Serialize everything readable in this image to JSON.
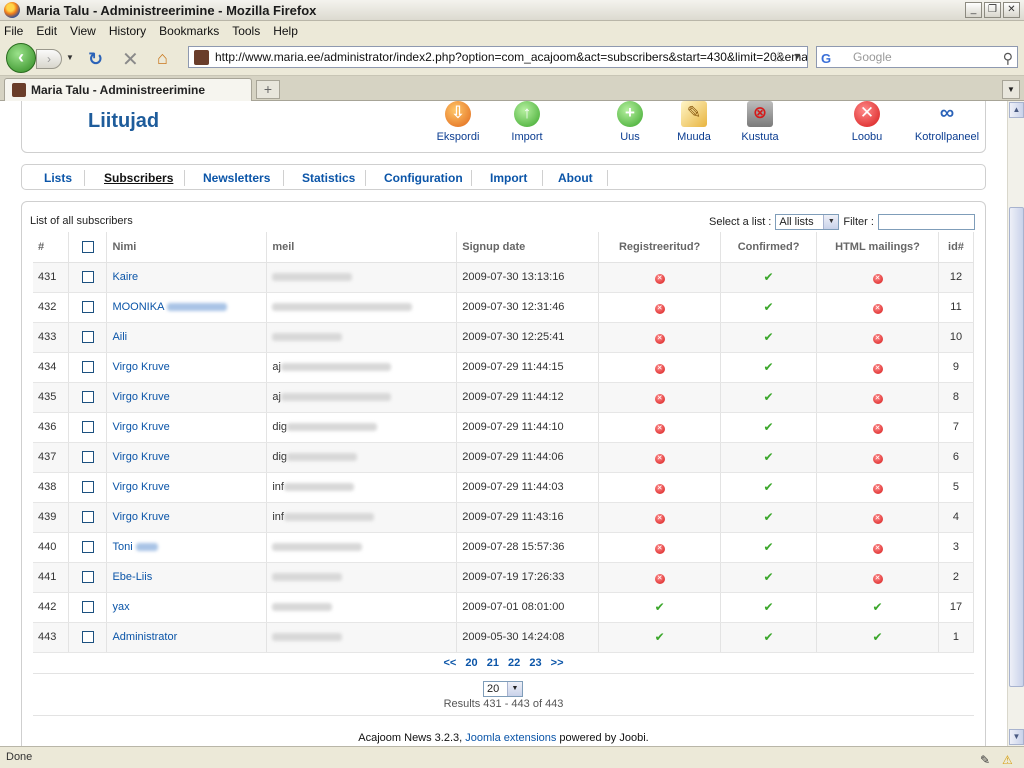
{
  "window": {
    "title": "Maria Talu - Administreerimine - Mozilla Firefox"
  },
  "menu": [
    "File",
    "Edit",
    "View",
    "History",
    "Bookmarks",
    "Tools",
    "Help"
  ],
  "nav": {
    "url": "http://www.maria.ee/administrator/index2.php?option=com_acajoom&act=subscribers&start=430&limit=20&emai",
    "search_placeholder": "Google"
  },
  "tab": {
    "label": "Maria Talu - Administreerimine"
  },
  "page": {
    "title": "Liitujad",
    "tools": [
      "Ekspordi",
      "Import",
      "Uus",
      "Muuda",
      "Kustuta",
      "Loobu",
      "Kotrollpaneel"
    ],
    "submenu": [
      "Lists",
      "Subscribers",
      "Newsletters",
      "Statistics",
      "Configuration",
      "Import",
      "About"
    ],
    "active_submenu": "Subscribers",
    "list_caption": "List of all subscribers",
    "select_label": "Select a list :",
    "select_value": "All lists",
    "filter_label": "Filter :",
    "columns": [
      "#",
      "",
      "Nimi",
      "meil",
      "Signup date",
      "Registreeritud?",
      "Confirmed?",
      "HTML mailings?",
      "id#"
    ],
    "rows": [
      {
        "num": "431",
        "name": "Kaire",
        "email": "",
        "date": "2009-07-30 13:13:16",
        "reg": "no",
        "conf": "yes",
        "html": "no",
        "id": "12"
      },
      {
        "num": "432",
        "name": "MOONIKA",
        "email": "",
        "date": "2009-07-30 12:31:46",
        "reg": "no",
        "conf": "yes",
        "html": "no",
        "id": "11"
      },
      {
        "num": "433",
        "name": "Aili",
        "email": "",
        "date": "2009-07-30 12:25:41",
        "reg": "no",
        "conf": "yes",
        "html": "no",
        "id": "10"
      },
      {
        "num": "434",
        "name": "Virgo Kruve",
        "email": "aj",
        "date": "2009-07-29 11:44:15",
        "reg": "no",
        "conf": "yes",
        "html": "no",
        "id": "9"
      },
      {
        "num": "435",
        "name": "Virgo Kruve",
        "email": "aj",
        "date": "2009-07-29 11:44:12",
        "reg": "no",
        "conf": "yes",
        "html": "no",
        "id": "8"
      },
      {
        "num": "436",
        "name": "Virgo Kruve",
        "email": "dig",
        "date": "2009-07-29 11:44:10",
        "reg": "no",
        "conf": "yes",
        "html": "no",
        "id": "7"
      },
      {
        "num": "437",
        "name": "Virgo Kruve",
        "email": "dig",
        "date": "2009-07-29 11:44:06",
        "reg": "no",
        "conf": "yes",
        "html": "no",
        "id": "6"
      },
      {
        "num": "438",
        "name": "Virgo Kruve",
        "email": "inf",
        "date": "2009-07-29 11:44:03",
        "reg": "no",
        "conf": "yes",
        "html": "no",
        "id": "5"
      },
      {
        "num": "439",
        "name": "Virgo Kruve",
        "email": "inf",
        "date": "2009-07-29 11:43:16",
        "reg": "no",
        "conf": "yes",
        "html": "no",
        "id": "4"
      },
      {
        "num": "440",
        "name": "Toni",
        "email": "",
        "date": "2009-07-28 15:57:36",
        "reg": "no",
        "conf": "yes",
        "html": "no",
        "id": "3"
      },
      {
        "num": "441",
        "name": "Ebe-Liis",
        "email": "",
        "date": "2009-07-19 17:26:33",
        "reg": "no",
        "conf": "yes",
        "html": "no",
        "id": "2"
      },
      {
        "num": "442",
        "name": "yax",
        "email": "",
        "date": "2009-07-01 08:01:00",
        "reg": "yes",
        "conf": "yes",
        "html": "yes",
        "id": "17"
      },
      {
        "num": "443",
        "name": "Administrator",
        "email": "",
        "date": "2009-05-30 14:24:08",
        "reg": "yes",
        "conf": "yes",
        "html": "yes",
        "id": "1"
      }
    ],
    "pager": [
      "<<",
      "20",
      "21",
      "22",
      "23",
      ">>"
    ],
    "limit": "20",
    "results": "Results 431 - 443 of 443",
    "footer_pre": "Acajoom News 3.2.3, ",
    "footer_link": "Joomla extensions",
    "footer_post": " powered by Joobi."
  },
  "status": {
    "text": "Done"
  },
  "colors": {
    "link": "#0b55a8",
    "title": "#1e5c9b",
    "ok": "#3aa62a",
    "no": "#d61a1a"
  }
}
